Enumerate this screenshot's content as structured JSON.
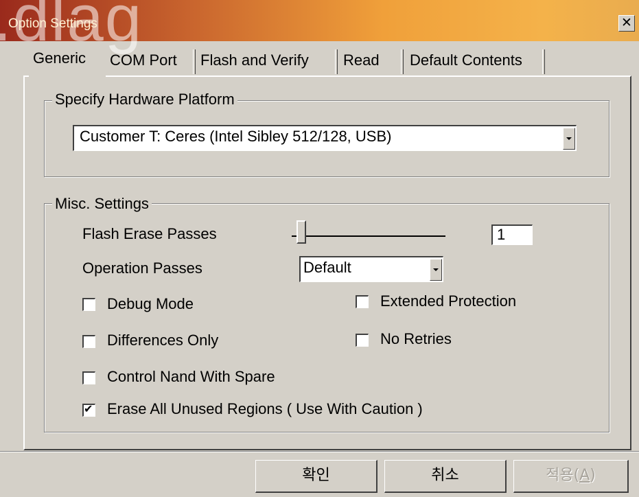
{
  "window": {
    "title": "Option Settings",
    "close_glyph": "✕",
    "watermark": ".dlag"
  },
  "tabs": [
    {
      "label": "Generic",
      "active": true
    },
    {
      "label": "COM Port",
      "active": false
    },
    {
      "label": "Flash and Verify",
      "active": false
    },
    {
      "label": "Read",
      "active": false
    },
    {
      "label": "Default Contents",
      "active": false
    }
  ],
  "hardware": {
    "legend": "Specify Hardware Platform",
    "selected": "Customer T: Ceres (Intel Sibley 512/128, USB)"
  },
  "misc": {
    "legend": "Misc. Settings",
    "flash_erase_passes_label": "Flash Erase Passes",
    "flash_erase_passes_value": "1",
    "flash_erase_passes_slider_fraction": 0.0,
    "operation_passes_label": "Operation Passes",
    "operation_passes_selected": "Default",
    "checkboxes": {
      "debug_mode": {
        "label": "Debug Mode",
        "checked": false
      },
      "extended_protection": {
        "label": "Extended Protection",
        "checked": false
      },
      "differences_only": {
        "label": "Differences Only",
        "checked": false
      },
      "no_retries": {
        "label": "No Retries",
        "checked": false
      },
      "control_nand": {
        "label": "Control Nand With Spare",
        "checked": false
      },
      "erase_unused": {
        "label": "Erase All Unused Regions ( Use With Caution )",
        "checked": true
      }
    },
    "check_glyph": "✔"
  },
  "buttons": {
    "ok": "확인",
    "cancel": "취소",
    "apply": "적용(A)"
  },
  "colors": {
    "dialog_bg": "#d4d0c8",
    "title_gradient_start": "#9a2a1c",
    "title_gradient_end": "#f4b24a"
  }
}
